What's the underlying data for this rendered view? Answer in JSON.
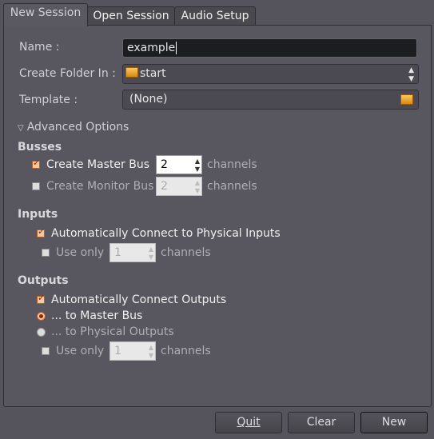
{
  "tabs": [
    "New Session",
    "Open Session",
    "Audio Setup"
  ],
  "form": {
    "name_label": "Name :",
    "name_value": "example",
    "folder_label": "Create Folder In :",
    "folder_value": "start",
    "template_label": "Template :",
    "template_value": "(None)"
  },
  "advanced": {
    "label": "Advanced Options",
    "busses": {
      "title": "Busses",
      "master_label": "Create Master Bus",
      "master_checked": true,
      "master_channels": "2",
      "monitor_label": "Create Monitor Bus",
      "monitor_checked": false,
      "monitor_channels": "2",
      "channels": "channels"
    },
    "inputs": {
      "title": "Inputs",
      "auto_label": "Automatically Connect to Physical Inputs",
      "auto_checked": true,
      "use_only_label": "Use only",
      "use_only_checked": false,
      "use_only_value": "1",
      "channels": "channels"
    },
    "outputs": {
      "title": "Outputs",
      "auto_label": "Automatically Connect Outputs",
      "auto_checked": true,
      "to_master": "... to Master Bus",
      "to_physical": "... to Physical Outputs",
      "selected": "to_master",
      "use_only_label": "Use only",
      "use_only_checked": false,
      "use_only_value": "1",
      "channels": "channels"
    }
  },
  "buttons": {
    "quit": "Quit",
    "clear": "Clear",
    "new": "New"
  }
}
